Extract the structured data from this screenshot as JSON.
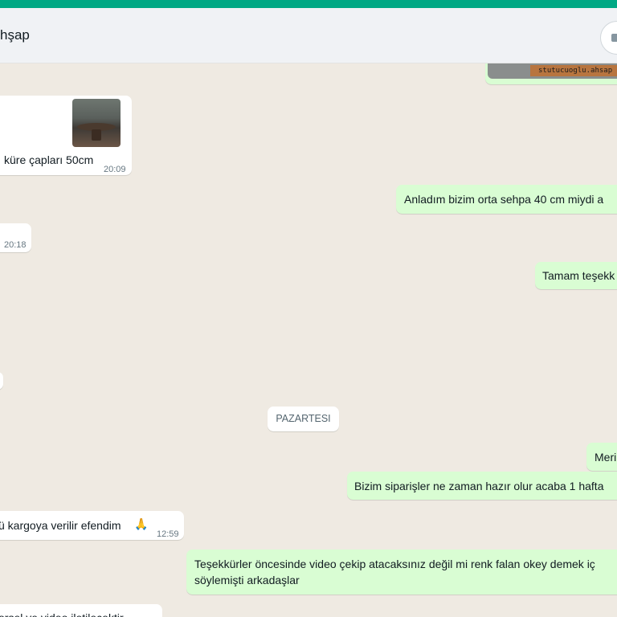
{
  "header": {
    "contact_name": "hşap"
  },
  "image_message": {
    "watermark": "stutucuoglu.ahsap"
  },
  "messages": [
    {
      "id": "m1",
      "direction": "in",
      "text": "küre çapları 50cm",
      "time": "20:09"
    },
    {
      "id": "m2",
      "direction": "out",
      "text": "Anladım bizim orta sehpa 40 cm miydi a",
      "time": ""
    },
    {
      "id": "m3",
      "direction": "in",
      "text": "",
      "time": "20:18"
    },
    {
      "id": "m4",
      "direction": "out",
      "text": "Tamam teşekk",
      "time": ""
    },
    {
      "id": "m5",
      "direction": "in",
      "text": "",
      "time": ""
    },
    {
      "id": "m6",
      "direction": "out",
      "text": "Meri",
      "time": ""
    },
    {
      "id": "m7",
      "direction": "out",
      "text": "Bizim siparişler ne zaman hazır olur acaba 1 hafta",
      "time": ""
    },
    {
      "id": "m8",
      "direction": "in",
      "text": "ü kargoya verilir efendim",
      "emoji": "🙏",
      "time": "12:59"
    },
    {
      "id": "m9",
      "direction": "out",
      "text_line1": "Teşekkürler öncesinde video çekip atacaksınız değil mi renk falan okey demek iç",
      "text_line2": "söylemişti arkadaşlar",
      "time": ""
    },
    {
      "id": "m10",
      "direction": "in",
      "text": "orsel ve video iletilecektir",
      "time": ""
    }
  ],
  "date_divider": "PAZARTESI",
  "colors": {
    "accent": "#00a884",
    "incoming_bubble": "#ffffff",
    "outgoing_bubble": "#d9fdd3",
    "chat_background": "#efeae2"
  },
  "icons": [
    "menu-icon"
  ]
}
